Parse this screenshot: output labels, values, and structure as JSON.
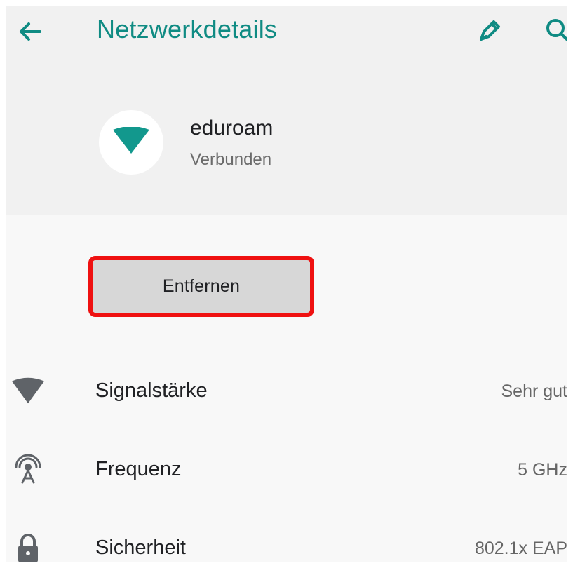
{
  "header": {
    "title": "Netzwerkdetails",
    "back_icon": "arrow-back-icon",
    "edit_icon": "pencil-icon",
    "search_icon": "search-icon",
    "accent_color": "#0F8B83"
  },
  "network": {
    "name": "eduroam",
    "status": "Verbunden",
    "icon": "wifi-icon"
  },
  "actions": {
    "forget_label": "Entfernen",
    "highlight_color": "#EF1111"
  },
  "details": [
    {
      "icon": "wifi-signal-icon",
      "label": "Signalstärke",
      "value": "Sehr gut"
    },
    {
      "icon": "antenna-icon",
      "label": "Frequenz",
      "value": "5 GHz"
    },
    {
      "icon": "lock-icon",
      "label": "Sicherheit",
      "value": "802.1x EAP"
    }
  ]
}
